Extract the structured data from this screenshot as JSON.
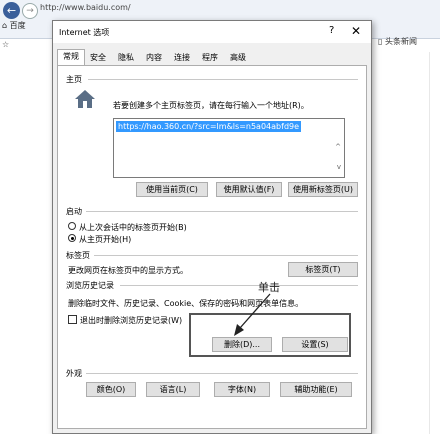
{
  "browser": {
    "address": "http://www.baidu.com/",
    "home_label": "百度",
    "right_label": "头条新闻"
  },
  "dialog": {
    "title": "Internet 选项",
    "help_label": "?",
    "close_label": "✕",
    "tabs": [
      {
        "label": "常规",
        "active": true
      },
      {
        "label": "安全"
      },
      {
        "label": "隐私"
      },
      {
        "label": "内容"
      },
      {
        "label": "连接"
      },
      {
        "label": "程序"
      },
      {
        "label": "高级"
      }
    ],
    "homepage": {
      "heading": "主页",
      "instruction": "若要创建多个主页标签页，请在每行输入一个地址(R)。",
      "url_value": "https://hao.360.cn/?src=lm&ls=n5a04abfd9e",
      "btn_current": "使用当前页(C)",
      "btn_default": "使用默认值(F)",
      "btn_newtab": "使用新标签页(U)"
    },
    "startup": {
      "heading": "启动",
      "option_last": "从上次会话中的标签页开始(B)",
      "option_home": "从主页开始(H)",
      "selected": "home"
    },
    "tabs_section": {
      "heading": "标签页",
      "description": "更改网页在标签页中的显示方式。",
      "button": "标签页(T)"
    },
    "history": {
      "heading": "浏览历史记录",
      "description": "删除临时文件、历史记录、Cookie、保存的密码和网页表单信息。",
      "checkbox_label": "退出时删除浏览历史记录(W)",
      "checkbox_checked": false,
      "btn_delete": "删除(D)...",
      "btn_settings": "设置(S)"
    },
    "appearance": {
      "heading": "外观",
      "btn_colors": "颜色(O)",
      "btn_languages": "语言(L)",
      "btn_fonts": "字体(N)",
      "btn_accessibility": "辅助功能(E)"
    }
  },
  "annotation": {
    "text": "单击"
  }
}
